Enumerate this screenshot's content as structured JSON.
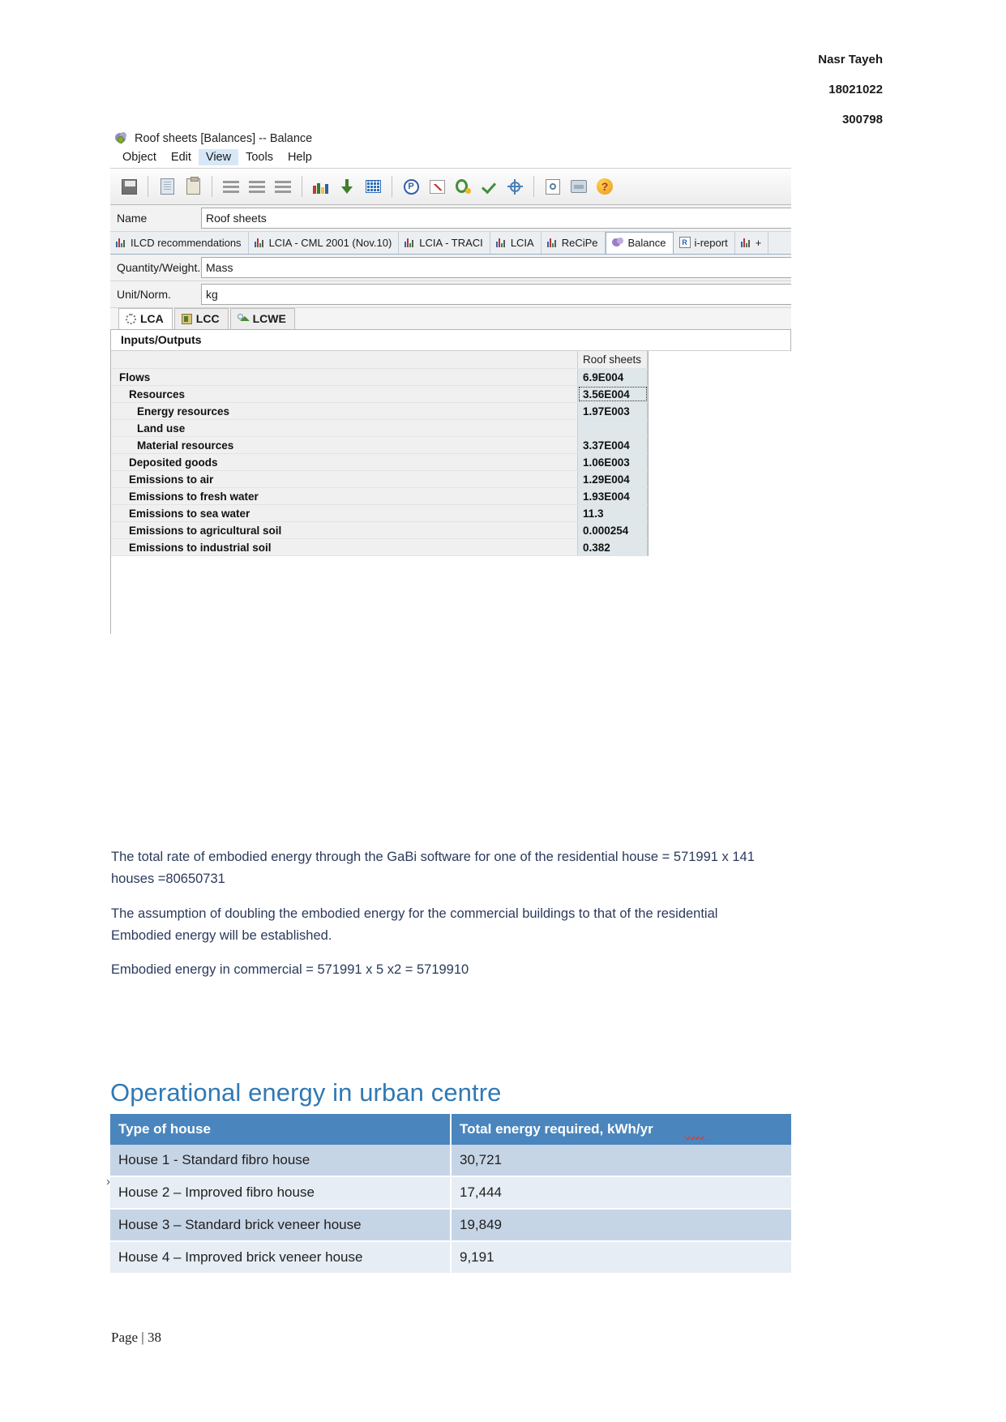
{
  "doc_header": {
    "name": "Nasr Tayeh",
    "student_id": "18021022",
    "code": "300798"
  },
  "gabi_window": {
    "title": "Roof sheets [Balances] -- Balance",
    "app_icon": "gabi-balance-icon",
    "menu": [
      {
        "label": "Object",
        "active": false
      },
      {
        "label": "Edit",
        "active": false
      },
      {
        "label": "View",
        "active": true
      },
      {
        "label": "Tools",
        "active": false
      },
      {
        "label": "Help",
        "active": false
      }
    ],
    "toolbar_icons": [
      "save-icon",
      "copy-icon",
      "paste-icon",
      "align-lines-icon",
      "align-lines-icon",
      "align-lines-icon",
      "books-icon",
      "down-arrow-icon",
      "grid-icon",
      "parameter-icon",
      "chart-icon",
      "quantity-icon",
      "check-icon",
      "balance-target-icon",
      "magnifier-icon",
      "drawer-icon",
      "help-icon"
    ],
    "name_field": {
      "label": "Name",
      "value": "Roof sheets"
    },
    "method_tabs": [
      {
        "label": "ILCD recommendations",
        "icon": "bar-chart-icon",
        "selected": false
      },
      {
        "label": "LCIA - CML 2001 (Nov.10)",
        "icon": "bar-chart-icon",
        "selected": false
      },
      {
        "label": "LCIA - TRACI",
        "icon": "bar-chart-icon",
        "selected": false
      },
      {
        "label": "LCIA",
        "icon": "bar-chart-icon",
        "selected": false
      },
      {
        "label": "ReCiPe",
        "icon": "bar-chart-icon",
        "selected": false
      },
      {
        "label": "Balance",
        "icon": "balance-icon",
        "selected": true
      },
      {
        "label": "i-report",
        "icon": "ireport-icon",
        "selected": false
      },
      {
        "label": "+",
        "icon": "bar-chart-icon",
        "selected": false
      }
    ],
    "quantity_field": {
      "label": "Quantity/Weight.",
      "value": "Mass"
    },
    "unit_field": {
      "label": "Unit/Norm.",
      "value": "kg"
    },
    "analysis_tabs": [
      {
        "label": "LCA",
        "icon": "gear-icon",
        "selected": true
      },
      {
        "label": "LCC",
        "icon": "cost-icon",
        "selected": false
      },
      {
        "label": "LCWE",
        "icon": "working-environment-icon",
        "selected": false
      }
    ],
    "section_header": "Inputs/Outputs",
    "grid": {
      "column_header": "Roof sheets",
      "rows": [
        {
          "label": "Flows",
          "value": "6.9E004",
          "indent": 0,
          "selected": false
        },
        {
          "label": "Resources",
          "value": "3.56E004",
          "indent": 1,
          "selected": true
        },
        {
          "label": "Energy resources",
          "value": "1.97E003",
          "indent": 2,
          "selected": false
        },
        {
          "label": "Land use",
          "value": "",
          "indent": 2,
          "selected": false
        },
        {
          "label": "Material resources",
          "value": "3.37E004",
          "indent": 2,
          "selected": false
        },
        {
          "label": "Deposited goods",
          "value": "1.06E003",
          "indent": 1,
          "selected": false
        },
        {
          "label": "Emissions to air",
          "value": "1.29E004",
          "indent": 1,
          "selected": false
        },
        {
          "label": "Emissions to fresh water",
          "value": "1.93E004",
          "indent": 1,
          "selected": false
        },
        {
          "label": "Emissions to sea water",
          "value": "11.3",
          "indent": 1,
          "selected": false
        },
        {
          "label": "Emissions to agricultural soil",
          "value": "0.000254",
          "indent": 1,
          "selected": false
        },
        {
          "label": "Emissions to industrial soil",
          "value": "0.382",
          "indent": 1,
          "selected": false
        }
      ]
    }
  },
  "body": {
    "paragraph_1": "The total rate of embodied energy through the GaBi software for one of the residential house = 571991 x 141 houses =80650731",
    "paragraph_2": "The assumption of doubling the embodied energy for the commercial buildings to that of the residential Embodied energy will be established.",
    "paragraph_3": "Embodied energy in commercial = 571991 x 5 x2  = 5719910"
  },
  "section": {
    "title": "Operational energy in urban centre"
  },
  "house_table": {
    "headers": [
      "Type of house",
      "Total energy required, kWh/yr"
    ],
    "rows": [
      {
        "type": "House 1 - Standard fibro house",
        "energy": "30,721"
      },
      {
        "type": "House 2 – Improved fibro house",
        "energy": "17,444"
      },
      {
        "type": "House 3 – Standard brick veneer house",
        "energy": "19,849"
      },
      {
        "type": "House 4 – Improved brick veneer house",
        "energy": "9,191"
      }
    ]
  },
  "footer": {
    "text": "Page | 38"
  },
  "colors": {
    "heading_blue": "#2f79b5",
    "table_header_blue": "#4a86bd",
    "body_text": "#2b3a5c",
    "row_odd": "#c6d5e6",
    "row_even": "#e6edf4"
  }
}
